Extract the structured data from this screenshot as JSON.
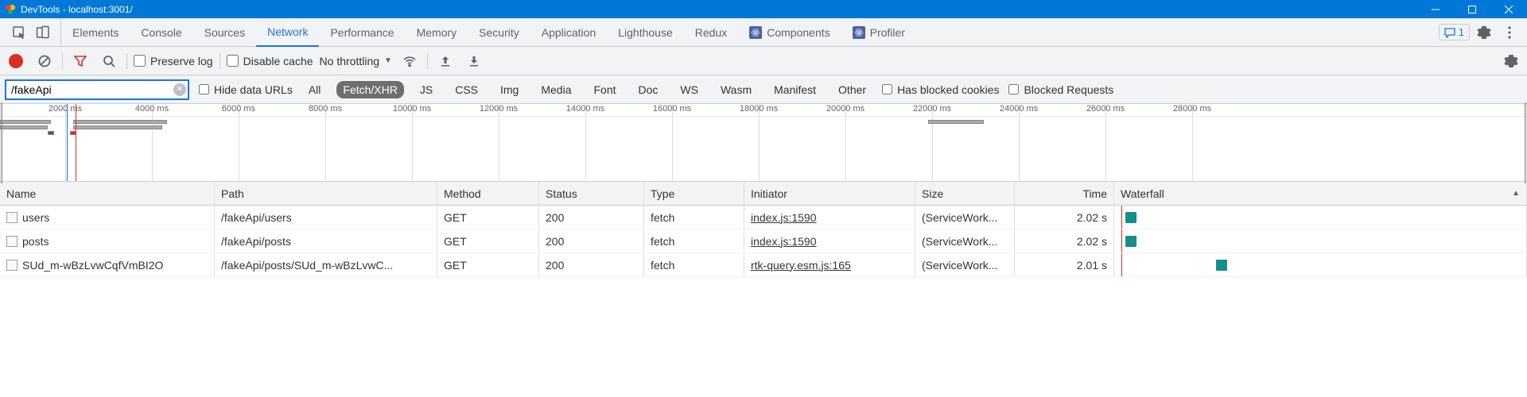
{
  "window": {
    "title": "DevTools - localhost:3001/"
  },
  "tabs": {
    "items": [
      "Elements",
      "Console",
      "Sources",
      "Network",
      "Performance",
      "Memory",
      "Security",
      "Application",
      "Lighthouse",
      "Redux",
      "Components",
      "Profiler"
    ],
    "active": "Network",
    "messages_count": "1"
  },
  "toolbar": {
    "preserve_log": "Preserve log",
    "disable_cache": "Disable cache",
    "throttling": "No throttling"
  },
  "filter": {
    "value": "/fakeApi",
    "hide_data_urls": "Hide data URLs",
    "types": [
      "All",
      "Fetch/XHR",
      "JS",
      "CSS",
      "Img",
      "Media",
      "Font",
      "Doc",
      "WS",
      "Wasm",
      "Manifest",
      "Other"
    ],
    "active_type": "Fetch/XHR",
    "has_blocked_cookies": "Has blocked cookies",
    "blocked_requests": "Blocked Requests"
  },
  "timeline": {
    "ticks": [
      "2000 ms",
      "4000 ms",
      "6000 ms",
      "8000 ms",
      "10000 ms",
      "12000 ms",
      "14000 ms",
      "16000 ms",
      "18000 ms",
      "20000 ms",
      "22000 ms",
      "24000 ms",
      "26000 ms",
      "28000 ms"
    ]
  },
  "table": {
    "headers": {
      "name": "Name",
      "path": "Path",
      "method": "Method",
      "status": "Status",
      "type": "Type",
      "initiator": "Initiator",
      "size": "Size",
      "time": "Time",
      "waterfall": "Waterfall"
    },
    "rows": [
      {
        "name": "users",
        "path": "/fakeApi/users",
        "method": "GET",
        "status": "200",
        "type": "fetch",
        "initiator": "index.js:1590",
        "size": "(ServiceWork...",
        "time": "2.02 s"
      },
      {
        "name": "posts",
        "path": "/fakeApi/posts",
        "method": "GET",
        "status": "200",
        "type": "fetch",
        "initiator": "index.js:1590",
        "size": "(ServiceWork...",
        "time": "2.02 s"
      },
      {
        "name": "SUd_m-wBzLvwCqfVmBI2O",
        "path": "/fakeApi/posts/SUd_m-wBzLvwC...",
        "method": "GET",
        "status": "200",
        "type": "fetch",
        "initiator": "rtk-query.esm.js:165",
        "size": "(ServiceWork...",
        "time": "2.01 s"
      }
    ]
  }
}
